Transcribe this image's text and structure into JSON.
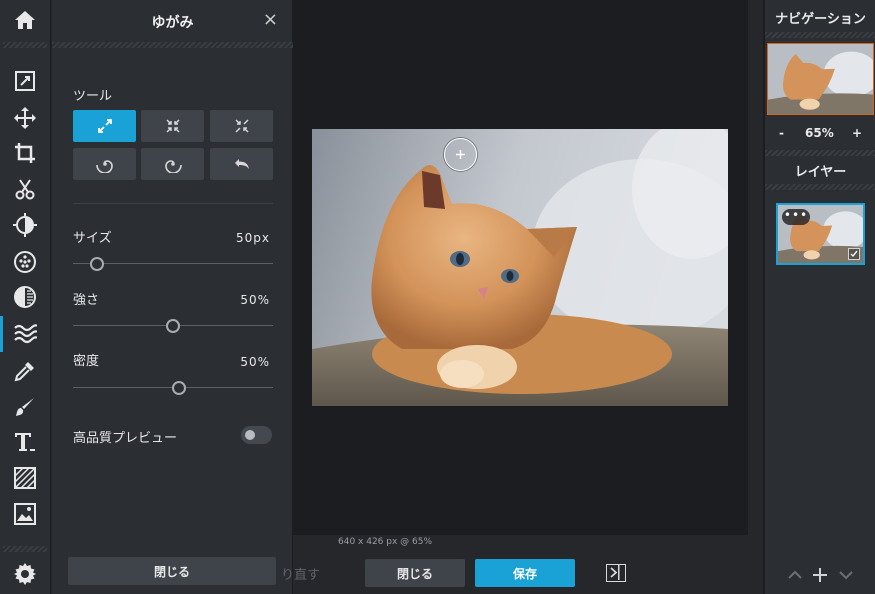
{
  "panel": {
    "title": "ゆがみ",
    "close_icon": "×",
    "tool_label": "ツール",
    "size_label": "サイズ",
    "size_value": "50px",
    "size_fraction": 0.12,
    "strength_label": "強さ",
    "strength_value": "50%",
    "strength_fraction": 0.5,
    "density_label": "密度",
    "density_value": "50%",
    "density_fraction": 0.53,
    "hq_preview_label": "高品質プレビュー",
    "hq_preview_on": false,
    "close_button_label": "閉じる",
    "tools": [
      "expand-icon",
      "shrink-icon",
      "pinch-icon",
      "twirl-left-icon",
      "twirl-right-icon",
      "undo-icon"
    ]
  },
  "toolbar": {
    "items": [
      "home-icon",
      "edit-icon",
      "move-icon",
      "crop-icon",
      "cut-icon",
      "adjust-icon",
      "filter-icon",
      "exposure-icon",
      "liquify-icon",
      "eyedropper-icon",
      "brush-icon",
      "text-icon",
      "pattern-icon",
      "image-icon"
    ],
    "active": "liquify-icon",
    "settings": "gear-icon"
  },
  "canvas": {
    "status_text": "640 x 426 px @ 65%"
  },
  "bottombar": {
    "redo_label": "り直す",
    "close_label": "閉じる",
    "save_label": "保存"
  },
  "right": {
    "navigation_title": "ナビゲーション",
    "zoom_minus": "-",
    "zoom_value": "65%",
    "zoom_plus": "+",
    "layers_title": "レイヤー",
    "layer_options": "•••",
    "layer_visible": true
  },
  "colors": {
    "accent": "#1aa1d6",
    "nav_border": "#d2661f",
    "panel_bg": "#2b2e33",
    "canvas_bg": "#1c1d20"
  }
}
